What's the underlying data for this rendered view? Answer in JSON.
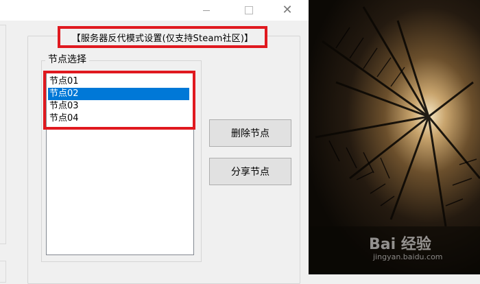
{
  "group": {
    "title": "【服务器反代模式设置(仅支持Steam社区)】",
    "node_section_label": "节点选择"
  },
  "nodes": [
    {
      "label": "节点01",
      "selected": false
    },
    {
      "label": "节点02",
      "selected": true
    },
    {
      "label": "节点03",
      "selected": false
    },
    {
      "label": "节点04",
      "selected": false
    }
  ],
  "buttons": {
    "delete": "删除节点",
    "share": "分享节点"
  },
  "window_controls": {
    "minimize_icon": "minimize-icon",
    "maximize_icon": "maximize-icon",
    "close_icon": "close-icon"
  },
  "watermark": {
    "main": "Bai 经验",
    "sub": "jingyan.baidu.com"
  },
  "colors": {
    "highlight_border": "#e0191f",
    "selection": "#0078d7"
  }
}
